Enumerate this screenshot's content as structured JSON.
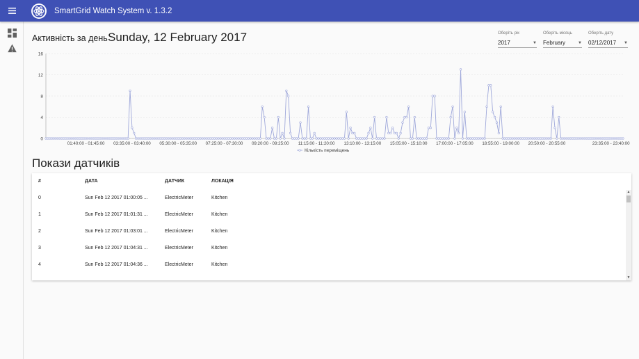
{
  "app": {
    "title": "SmartGrid Watch System v. 1.3.2"
  },
  "page": {
    "activity_label": "Активність за день",
    "date_title": "Sunday, 12 February 2017"
  },
  "selectors": [
    {
      "label": "Оберіть рік",
      "value": "2017"
    },
    {
      "label": "Оберіть місяць",
      "value": "February"
    },
    {
      "label": "Оберіть дату",
      "value": "02/12/2017"
    }
  ],
  "chart_data": {
    "type": "line",
    "title": "",
    "xlabel": "",
    "ylabel": "",
    "ylim": [
      0,
      16
    ],
    "yticks": [
      0,
      4,
      8,
      12,
      16
    ],
    "grid": true,
    "legend_position": "bottom",
    "series": [
      {
        "name": "Кількість переміщень",
        "color": "#9fa8da",
        "values": [
          0,
          0,
          0,
          0,
          0,
          0,
          0,
          0,
          0,
          0,
          0,
          0,
          0,
          0,
          0,
          0,
          0,
          0,
          0,
          0,
          0,
          0,
          0,
          0,
          0,
          0,
          0,
          0,
          0,
          0,
          0,
          0,
          0,
          0,
          0,
          0,
          0,
          0,
          0,
          0,
          0,
          0,
          9,
          2,
          1,
          0,
          0,
          0,
          0,
          0,
          0,
          0,
          0,
          0,
          0,
          0,
          0,
          0,
          0,
          0,
          0,
          0,
          0,
          0,
          0,
          0,
          0,
          0,
          0,
          0,
          0,
          0,
          0,
          0,
          0,
          0,
          0,
          0,
          0,
          0,
          0,
          0,
          0,
          0,
          0,
          0,
          0,
          0,
          0,
          0,
          0,
          0,
          0,
          0,
          0,
          0,
          0,
          0,
          0,
          0,
          0,
          0,
          0,
          0,
          0,
          0,
          0,
          0,
          6,
          4,
          0,
          0,
          0,
          2,
          0,
          0,
          4,
          0,
          1,
          0,
          9,
          8,
          1,
          0,
          0,
          0,
          0,
          3,
          0,
          0,
          0,
          6,
          0,
          0,
          1,
          0,
          0,
          0,
          0,
          0,
          0,
          0,
          0,
          0,
          0,
          0,
          0,
          0,
          0,
          0,
          5,
          0,
          2,
          1,
          1,
          0,
          0,
          0,
          0,
          0,
          0,
          1,
          2,
          0,
          4,
          0,
          0,
          0,
          0,
          0,
          4,
          1,
          1,
          2,
          1,
          1,
          0,
          1,
          3,
          4,
          4,
          6,
          0,
          0,
          4,
          0,
          0,
          0,
          0,
          0,
          0,
          2,
          2,
          8,
          8,
          0,
          0,
          0,
          0,
          0,
          0,
          0,
          4,
          6,
          0,
          2,
          1,
          13,
          0,
          5,
          0,
          0,
          0,
          0,
          0,
          0,
          0,
          0,
          0,
          0,
          6,
          10,
          10,
          5,
          4,
          3,
          1,
          6,
          0,
          0,
          0,
          0,
          0,
          0,
          0,
          0,
          0,
          0,
          0,
          0,
          0,
          0,
          0,
          0,
          0,
          0,
          0,
          0,
          0,
          0,
          0,
          0,
          0,
          6,
          2,
          0,
          4,
          0,
          0,
          0,
          0,
          0,
          0,
          0,
          0,
          0,
          0,
          0,
          0,
          0,
          0,
          0,
          0,
          0,
          0,
          0,
          0,
          0,
          0,
          0,
          0,
          0,
          0,
          0,
          0,
          0,
          0,
          0,
          0
        ]
      }
    ],
    "xticks": [
      "01:40:00 - 01:45:00",
      "03:35:00 - 03:40:00",
      "05:30:00 - 05:35:00",
      "07:25:00 - 07:30:00",
      "09:20:00 - 09:25:00",
      "11:15:00 - 11:20:00",
      "13:10:00 - 13:15:00",
      "15:05:00 - 15:10:00",
      "17:00:00 - 17:05:00",
      "18:55:00 - 19:00:00",
      "20:50:00 - 20:55:00",
      "23:35:00 - 23:40:00"
    ],
    "xtick_index": [
      20,
      43,
      66,
      89,
      112,
      135,
      158,
      181,
      204,
      227,
      250,
      282
    ]
  },
  "sensors": {
    "title": "Покази датчиків",
    "headers": [
      "#",
      "ДАТА",
      "ДАТЧИК",
      "ЛОКАЦІЯ"
    ],
    "rows": [
      {
        "id": "0",
        "date": "Sun Feb 12 2017 01:00:05 ...",
        "sensor": "ElectricMeter",
        "location": "Kitchen"
      },
      {
        "id": "1",
        "date": "Sun Feb 12 2017 01:01:31 ...",
        "sensor": "ElectricMeter",
        "location": "Kitchen"
      },
      {
        "id": "2",
        "date": "Sun Feb 12 2017 01:03:01 ...",
        "sensor": "ElectricMeter",
        "location": "Kitchen"
      },
      {
        "id": "3",
        "date": "Sun Feb 12 2017 01:04:31 ...",
        "sensor": "ElectricMeter",
        "location": "Kitchen"
      },
      {
        "id": "4",
        "date": "Sun Feb 12 2017 01:04:36 ...",
        "sensor": "ElectricMeter",
        "location": "Kitchen"
      }
    ]
  }
}
